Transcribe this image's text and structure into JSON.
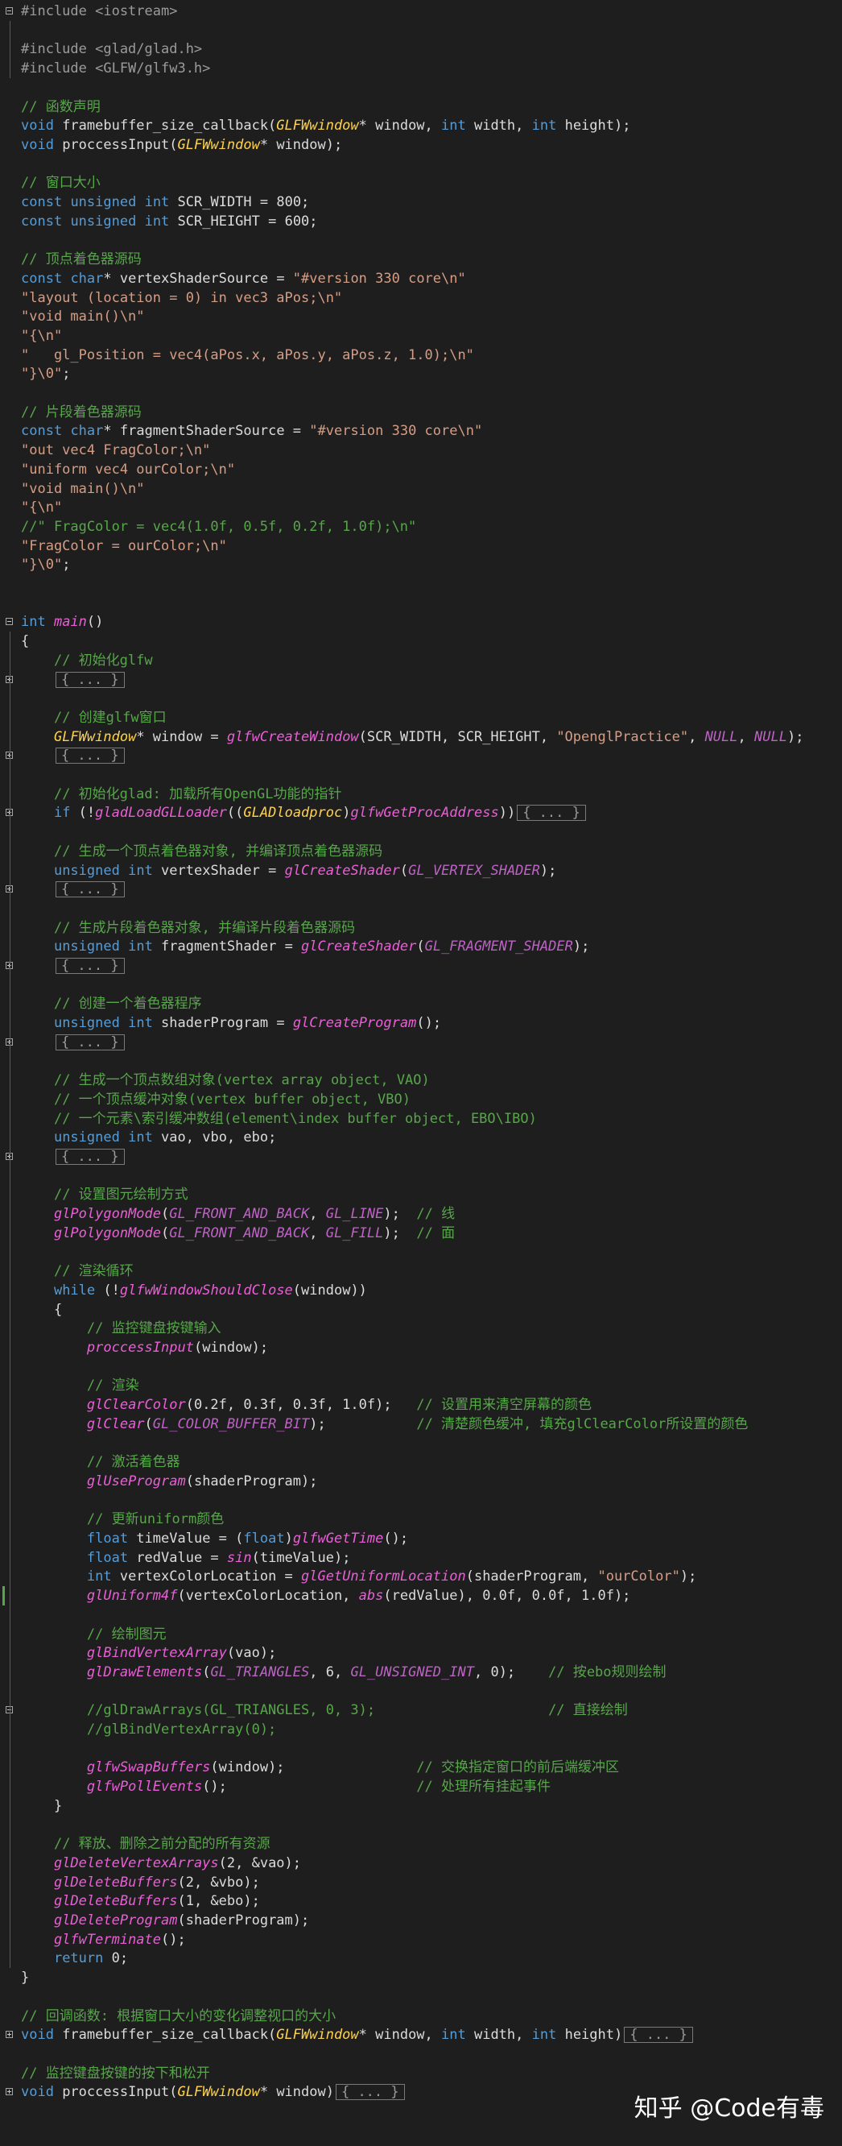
{
  "editor": {
    "lines": [
      {
        "text": "#include <iostream>",
        "row": 0
      },
      {
        "text": "",
        "row": 1
      },
      {
        "text": "#include <glad/glad.h>",
        "row": 2
      },
      {
        "text": "#include <GLFW/glfw3.h>",
        "row": 3
      },
      {
        "text": "",
        "row": 4
      },
      {
        "text": "// 函数声明",
        "row": 5
      },
      {
        "text": "void framebuffer_size_callback(GLFWwindow* window, int width, int height);",
        "row": 6
      },
      {
        "text": "void proccessInput(GLFWwindow* window);",
        "row": 7
      }
    ]
  },
  "code": {
    "include_iostream": "#include <iostream>",
    "include_glad": "#include <glad/glad.h>",
    "include_glfw": "#include <GLFW/glfw3.h>",
    "c_func_decl": "// 函数声明",
    "c_window_size": "// 窗口大小",
    "c_vertex_src": "// 顶点着色器源码",
    "c_fragment_src": "// 片段着色器源码",
    "c_init_glfw": "// 初始化glfw",
    "c_create_window": "// 创建glfw窗口",
    "c_init_glad": "// 初始化glad: 加载所有OpenGL功能的指针",
    "c_vertex_obj": "// 生成一个顶点着色器对象, 并编译顶点着色器源码",
    "c_fragment_obj": "// 生成片段着色器对象, 并编译片段着色器源码",
    "c_program": "// 创建一个着色器程序",
    "c_vao": "// 生成一个顶点数组对象(vertex array object, VAO)",
    "c_vbo": "// 一个顶点缓冲对象(vertex buffer object, VBO)",
    "c_ebo": "// 一个元素\\索引缓冲数组(element\\index buffer object, EBO\\IBO)",
    "c_polygon_mode": "// 设置图元绘制方式",
    "c_line": "// 线",
    "c_fill": "// 面",
    "c_render_loop": "// 渲染循环",
    "c_keyboard_input": "// 监控键盘按键输入",
    "c_render": "// 渲染",
    "c_clear_color": "// 设置用来清空屏幕的颜色",
    "c_clear": "// 清楚颜色缓冲, 填充glClearColor所设置的颜色",
    "c_activate_shader": "// 激活着色器",
    "c_update_uniform": "// 更新uniform颜色",
    "c_draw": "// 绘制图元",
    "c_draw_ebo": "// 按ebo规则绘制",
    "c_draw_direct": "// 直接绘制",
    "c_draw_arrays": "//glDrawArrays(GL_TRIANGLES, 0, 3);",
    "c_bind_zero": "//glBindVertexArray(0);",
    "c_swap": "// 交换指定窗口的前后端缓冲区",
    "c_poll": "// 处理所有挂起事件",
    "c_release": "// 释放、删除之前分配的所有资源",
    "c_callback": "// 回调函数: 根据窗口大小的变化调整视口的大小",
    "c_key_press": "// 监控键盘按键的按下和松开",
    "collapsed": "{ ... }"
  },
  "watermark": {
    "text": "知乎 @Code有毒"
  }
}
